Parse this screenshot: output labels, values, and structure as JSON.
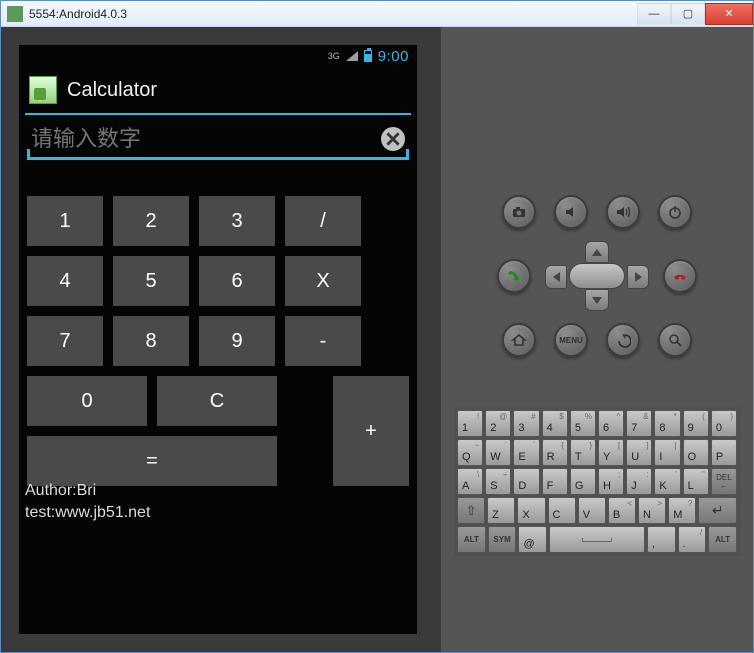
{
  "window": {
    "title": "5554:Android4.0.3"
  },
  "status": {
    "net": "3G",
    "time": "9:00"
  },
  "app": {
    "title": "Calculator",
    "input_placeholder": "请输入数字"
  },
  "keys": {
    "k1": "1",
    "k2": "2",
    "k3": "3",
    "k4": "4",
    "k5": "5",
    "k6": "6",
    "k7": "7",
    "k8": "8",
    "k9": "9",
    "k0": "0",
    "div": "/",
    "mul": "X",
    "sub": "-",
    "add": "+",
    "clr": "C",
    "eq": "="
  },
  "footer": {
    "author": "Author:Bri",
    "test": "test:www.jb51.net"
  },
  "hw": {
    "menu": "MENU",
    "alt": "ALT",
    "sym": "SYM",
    "del": "DEL"
  },
  "kbd": {
    "r1": [
      {
        "m": "1",
        "a": "!"
      },
      {
        "m": "2",
        "a": "@"
      },
      {
        "m": "3",
        "a": "#"
      },
      {
        "m": "4",
        "a": "$"
      },
      {
        "m": "5",
        "a": "%"
      },
      {
        "m": "6",
        "a": "^"
      },
      {
        "m": "7",
        "a": "&"
      },
      {
        "m": "8",
        "a": "*"
      },
      {
        "m": "9",
        "a": "("
      },
      {
        "m": "0",
        "a": ")"
      }
    ],
    "r2": [
      {
        "m": "Q",
        "a": "~"
      },
      {
        "m": "W",
        "a": "`"
      },
      {
        "m": "E",
        "a": "´"
      },
      {
        "m": "R",
        "a": "{"
      },
      {
        "m": "T",
        "a": "}"
      },
      {
        "m": "Y",
        "a": "["
      },
      {
        "m": "U",
        "a": "]"
      },
      {
        "m": "I",
        "a": "|"
      },
      {
        "m": "O",
        "a": ""
      },
      {
        "m": "P",
        "a": ""
      }
    ],
    "r3": [
      {
        "m": "A",
        "a": "\\"
      },
      {
        "m": "S",
        "a": "÷"
      },
      {
        "m": "D",
        "a": ""
      },
      {
        "m": "F",
        "a": ""
      },
      {
        "m": "G",
        "a": ""
      },
      {
        "m": "H",
        "a": ";"
      },
      {
        "m": "J",
        "a": ":"
      },
      {
        "m": "K",
        "a": "'"
      },
      {
        "m": "L",
        "a": "\""
      }
    ],
    "r4": [
      {
        "m": "Z",
        "a": ""
      },
      {
        "m": "X",
        "a": ""
      },
      {
        "m": "C",
        "a": ""
      },
      {
        "m": "V",
        "a": ""
      },
      {
        "m": "B",
        "a": "<"
      },
      {
        "m": "N",
        "a": ">"
      },
      {
        "m": "M",
        "a": "?"
      }
    ],
    "r5": {
      "at": "@",
      "comma": ",",
      "period": ".",
      "slash": "/"
    }
  }
}
